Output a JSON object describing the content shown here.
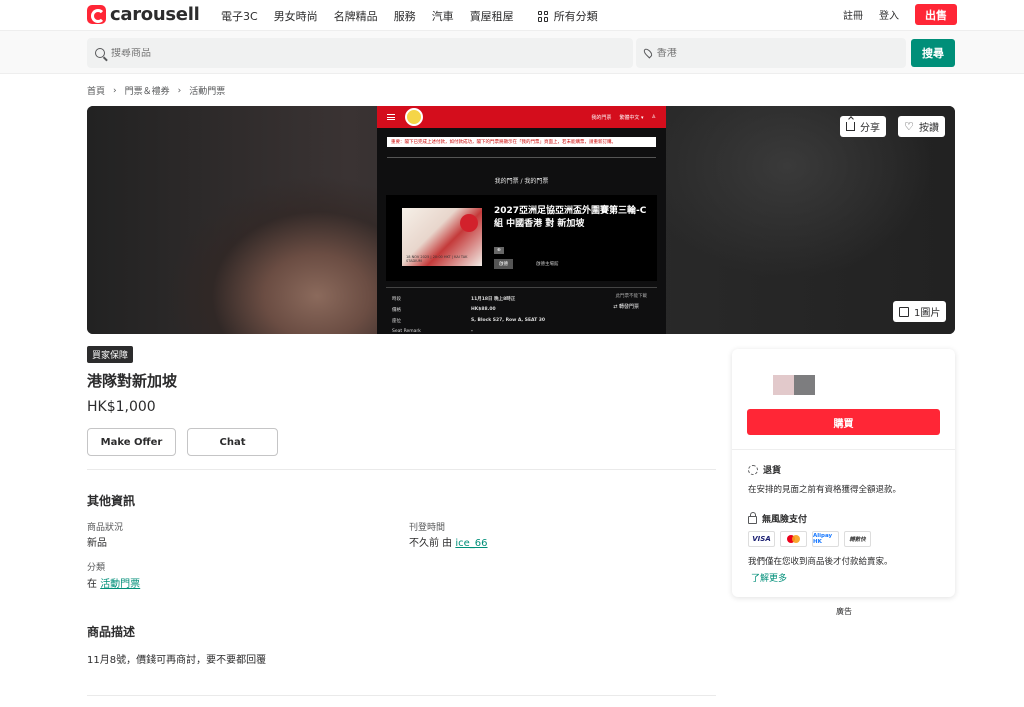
{
  "header": {
    "logo_text": "carousell",
    "nav": [
      "電子3C",
      "男女時尚",
      "名牌精品",
      "服務",
      "汽車",
      "賣屋租屋"
    ],
    "nav_all": "所有分類",
    "register": "註冊",
    "login": "登入",
    "sell": "出售"
  },
  "search": {
    "placeholder": "搜尋商品",
    "location_placeholder": "香港",
    "button": "搜尋"
  },
  "breadcrumb": [
    "首頁",
    "門票＆禮券",
    "活動門票"
  ],
  "hero": {
    "share": "分享",
    "like": "按讚",
    "image_count": "1圖片",
    "ticket": {
      "header_links": [
        "我的門票",
        "繁體中文 ▾"
      ],
      "notice": "重要：閣下已完成上述付款，如付款成功，閣下的門票將顯示在「我的門票」頁面上，若未能購票，請重新訂購。",
      "crumb": "我的門票 / 我的門票",
      "poster_text": "18 NOV 2025 | 20:00 HKT | KAI TAK STADIUM",
      "event_title": "2027亞洲足協亞洲盃外圍賽第三輪-C組 中國香港 對 新加坡",
      "tag1": "⊕",
      "tag2": "啟德",
      "venue": "啟德主場館",
      "rows": [
        {
          "k": "時段",
          "v": "11月18日 晚上8時正"
        },
        {
          "k": "價格",
          "v": "HK$88.00"
        },
        {
          "k": "座位",
          "v": "S, Block S27, Row A, SEAT 30"
        },
        {
          "k": "Seat Remark",
          "v": "-"
        }
      ],
      "side_note": "此門票不能下載",
      "side_action": "轉發門票"
    }
  },
  "listing": {
    "badge": "買家保障",
    "title": "港隊對新加坡",
    "price": "HK$1,000",
    "make_offer": "Make Offer",
    "chat": "Chat"
  },
  "info": {
    "section_title": "其他資訊",
    "condition_label": "商品狀況",
    "condition_value": "新品",
    "posted_label": "刊登時間",
    "posted_prefix": "不久前 由",
    "posted_user": "ice_66",
    "category_label": "分類",
    "category_prefix": "在",
    "category_value": "活動門票"
  },
  "description": {
    "section_title": "商品描述",
    "text": "11月8號，價錢可再商討，要不要都回覆"
  },
  "panel": {
    "buy": "購買",
    "refund_title": "退貨",
    "refund_text": "在安排的見面之前有資格獲得全額退款。",
    "payment_title": "無風險支付",
    "payment_methods": [
      "VISA",
      "Mastercard",
      "Alipay HK",
      "轉數快"
    ],
    "payment_text": "我們僅在您收到商品後才付款給賣家。",
    "learn_more": "了解更多",
    "swatch_colors": [
      "#e2c9cb",
      "#7d7d7f"
    ]
  },
  "ad_label": "廣告",
  "colors": {
    "brand_red": "#ff2636",
    "brand_green": "#008f79"
  }
}
